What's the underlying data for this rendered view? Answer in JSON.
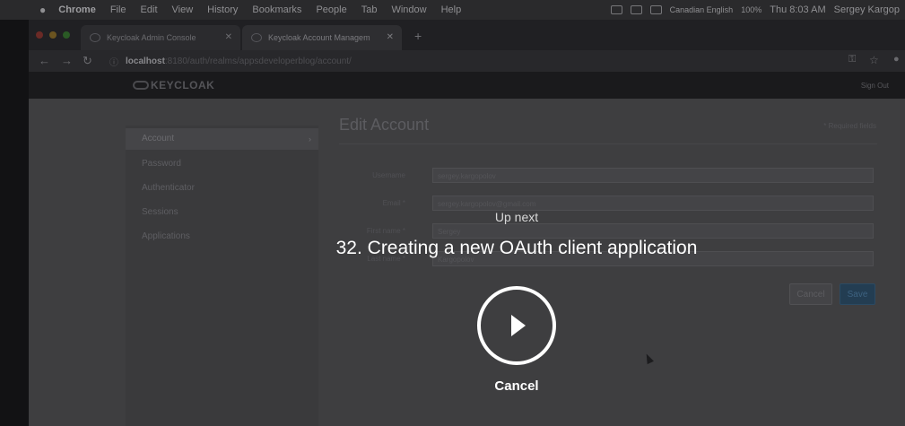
{
  "menubar": {
    "items": [
      "Chrome",
      "File",
      "Edit",
      "View",
      "History",
      "Bookmarks",
      "People",
      "Tab",
      "Window",
      "Help"
    ],
    "status": {
      "input_source": "Canadian English",
      "battery": "100%",
      "clock": "Thu 8:03 AM",
      "user": "Sergey Kargop"
    }
  },
  "tabs": [
    {
      "label": "Keycloak Admin Console",
      "active": false
    },
    {
      "label": "Keycloak Account Managem",
      "active": true
    }
  ],
  "address": {
    "host": "localhost",
    "path": ":8180/auth/realms/appsdeveloperblog/account/"
  },
  "keycloak": {
    "logo": "KEYCLOAK",
    "sign_out": "Sign Out",
    "sidebar": [
      "Account",
      "Password",
      "Authenticator",
      "Sessions",
      "Applications"
    ],
    "page_title": "Edit Account",
    "required_note": "* Required fields",
    "fields": [
      {
        "label": "Username",
        "value": "sergey.kargopolov",
        "required": false
      },
      {
        "label": "Email",
        "value": "sergey.kargopolov@gmail.com",
        "required": true
      },
      {
        "label": "First name",
        "value": "Sergey",
        "required": true
      },
      {
        "label": "Last name",
        "value": "Kargopolov",
        "required": true
      }
    ],
    "cancel_label": "Cancel",
    "save_label": "Save"
  },
  "overlay": {
    "up_next": "Up next",
    "next_title": "32. Creating a new OAuth client application",
    "cancel_label": "Cancel"
  },
  "colors": {
    "overlay_text": "#ffffff",
    "save_button": "#233d52"
  }
}
